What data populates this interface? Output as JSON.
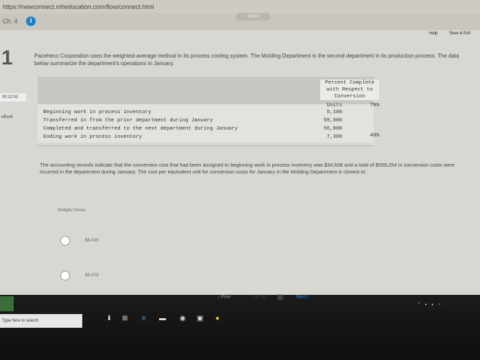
{
  "browser": {
    "url": "https://newconnect.mheducation.com/flow/connect.html"
  },
  "header": {
    "chapter": "Ch. 4",
    "info_icon": "info-icon",
    "status": "Saved",
    "help": "Help",
    "save_exit": "Save & Exit"
  },
  "sidebar": {
    "question_number": "1",
    "timer": "00:12:03",
    "ebook": "eBook"
  },
  "question": {
    "text": "Paceheco Corporation uses the weighted-average method in its process costing system. The Molding Department is the second department in its production process. The data below summarize the department's operations in January.",
    "table": {
      "headers": {
        "units": "Units",
        "percent": "Percent Complete with Respect to Conversion"
      },
      "rows": [
        {
          "label": "Beginning work in process inventory",
          "units": "5,100",
          "percent": "70%"
        },
        {
          "label": "Transferred in from the prior department during January",
          "units": "59,000",
          "percent": ""
        },
        {
          "label": "Completed and transferred to the next department during January",
          "units": "56,800",
          "percent": ""
        },
        {
          "label": "Ending work in process inventory",
          "units": "7,300",
          "percent": "40%"
        }
      ]
    },
    "followup": "The accounting records indicate that the conversion cost that had been assigned to beginning work in process inventory was $34,558 and a total of $559,254 in conversion costs were incurred in the department during January. The cost per equivalent unit for conversion costs for January in the Molding Department is closest to:",
    "mc_label": "Multiple Choice",
    "options": [
      "$8.435",
      "$9.479"
    ]
  },
  "pager": {
    "prev": "Prev",
    "page_info": "1 of 10",
    "grid_icon": "grid-icon",
    "next": "Next"
  },
  "taskbar": {
    "search": "Type here to search"
  }
}
